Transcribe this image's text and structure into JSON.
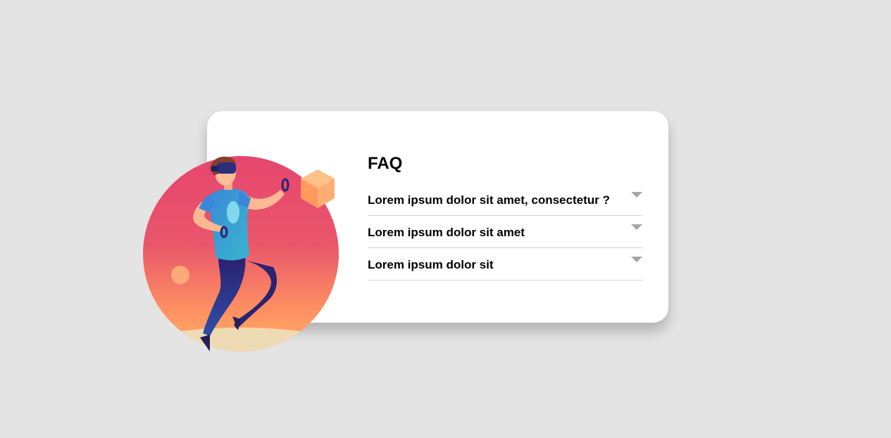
{
  "faq": {
    "title": "FAQ",
    "items": [
      {
        "question": "Lorem ipsum dolor sit amet, consectetur ?"
      },
      {
        "question": "Lorem ipsum dolor sit amet"
      },
      {
        "question": "Lorem ipsum dolor sit"
      }
    ]
  },
  "colors": {
    "background": "#e4e4e4",
    "card": "#ffffff",
    "circle_top": "#e6466e",
    "circle_bottom": "#ffa560",
    "ground": "#eedbb4",
    "caret": "#a6a6a6",
    "divider": "#cfcfcf"
  },
  "icons": {
    "caret": "caret-down-icon",
    "illustration": "vr-person-illustration"
  }
}
